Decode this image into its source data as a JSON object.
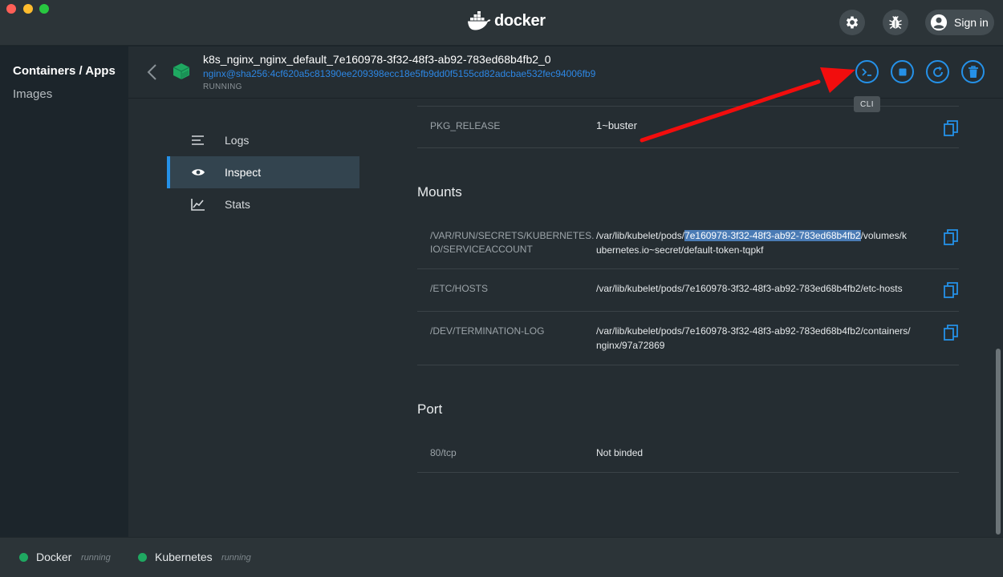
{
  "window": {
    "brand": "docker"
  },
  "titlebar": {
    "signin_label": "Sign in"
  },
  "leftnav": {
    "items": [
      {
        "label": "Containers / Apps"
      },
      {
        "label": "Images"
      }
    ]
  },
  "container": {
    "name": "k8s_nginx_nginx_default_7e160978-3f32-48f3-ab92-783ed68b4fb2_0",
    "image": "nginx@sha256:4cf620a5c81390ee209398ecc18e5fb9dd0f5155cd82adcbae532fec94006fb9",
    "status": "RUNNING",
    "tooltip": "CLI"
  },
  "tabs": [
    {
      "label": "Logs"
    },
    {
      "label": "Inspect"
    },
    {
      "label": "Stats"
    }
  ],
  "env_row": {
    "key": "PKG_RELEASE",
    "value": "1~buster"
  },
  "mounts": {
    "title": "Mounts",
    "rows": [
      {
        "key_line1": "/VAR/RUN/SECRETS/KUBERNETES.",
        "key_line2": "IO/SERVICEACCOUNT",
        "val_prefix": "/var/lib/kubelet/pods/",
        "val_highlight": "7e160978-3f32-48f3-ab92-783ed68b4fb2",
        "val_suffix": "/volumes/k",
        "val_line2": "ubernetes.io~secret/default-token-tqpkf"
      },
      {
        "key": "/ETC/HOSTS",
        "value": "/var/lib/kubelet/pods/7e160978-3f32-48f3-ab92-783ed68b4fb2/etc-hosts"
      },
      {
        "key": "/DEV/TERMINATION-LOG",
        "value_line1": "/var/lib/kubelet/pods/7e160978-3f32-48f3-ab92-783ed68b4fb2/containers/",
        "value_line2": "nginx/97a72869"
      }
    ]
  },
  "port": {
    "title": "Port",
    "rows": [
      {
        "key": "80/tcp",
        "value": "Not binded"
      }
    ]
  },
  "statusbar": {
    "items": [
      {
        "name": "Docker",
        "state": "running"
      },
      {
        "name": "Kubernetes",
        "state": "running"
      }
    ]
  },
  "colors": {
    "accent": "#2591e8",
    "running": "#1fa861",
    "annotation_arrow": "#f20d0d"
  }
}
